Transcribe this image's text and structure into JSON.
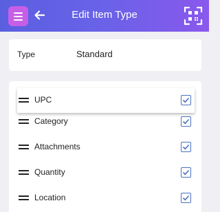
{
  "header": {
    "title": "Edit Item Type",
    "menu_icon": "hamburger-menu-icon",
    "back_icon": "arrow-left-icon",
    "scan_icon": "scan-icon"
  },
  "type_section": {
    "label": "Type",
    "value": "Standard"
  },
  "fields": [
    {
      "label": "UPC",
      "checked": true
    },
    {
      "label": "Category",
      "checked": true
    },
    {
      "label": "Attachments",
      "checked": true
    },
    {
      "label": "Quantity",
      "checked": true
    },
    {
      "label": "Location",
      "checked": true
    }
  ],
  "colors": {
    "header_gradient_start": "#5a5fe0",
    "header_gradient_end": "#8a58ec",
    "menu_button": "#c65fe8",
    "checkbox": "#4a72c0",
    "background": "#efeff4"
  }
}
